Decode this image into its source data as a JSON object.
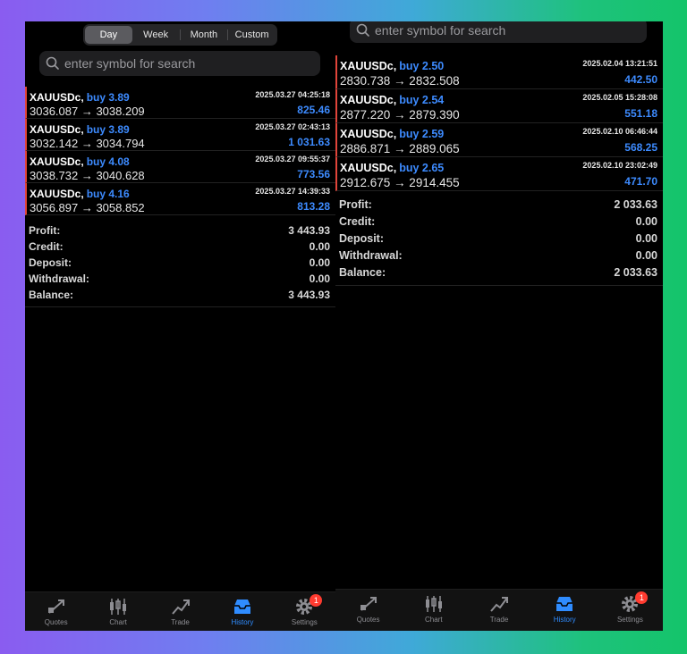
{
  "left": {
    "period_tabs": [
      "Day",
      "Week",
      "Month",
      "Custom"
    ],
    "active_period": "Day",
    "search": {
      "placeholder": "enter symbol for search"
    },
    "deals": [
      {
        "symbol": "XAUUSDc,",
        "side": "buy 3.89",
        "time": "2025.03.27 04:25:18",
        "prices": "3036.087 → 3038.209",
        "profit": "825.46"
      },
      {
        "symbol": "XAUUSDc,",
        "side": "buy 3.89",
        "time": "2025.03.27 02:43:13",
        "prices": "3032.142 → 3034.794",
        "profit": "1 031.63"
      },
      {
        "symbol": "XAUUSDc,",
        "side": "buy 4.08",
        "time": "2025.03.27 09:55:37",
        "prices": "3038.732 → 3040.628",
        "profit": "773.56"
      },
      {
        "symbol": "XAUUSDc,",
        "side": "buy 4.16",
        "time": "2025.03.27 14:39:33",
        "prices": "3056.897 → 3058.852",
        "profit": "813.28"
      }
    ],
    "summary": [
      {
        "label": "Profit:",
        "value": "3 443.93"
      },
      {
        "label": "Credit:",
        "value": "0.00"
      },
      {
        "label": "Deposit:",
        "value": "0.00"
      },
      {
        "label": "Withdrawal:",
        "value": "0.00"
      },
      {
        "label": "Balance:",
        "value": "3 443.93"
      }
    ],
    "tabs": [
      {
        "label": "Quotes",
        "icon": "quotes-icon"
      },
      {
        "label": "Chart",
        "icon": "chart-icon"
      },
      {
        "label": "Trade",
        "icon": "trade-icon"
      },
      {
        "label": "History",
        "icon": "history-icon"
      },
      {
        "label": "Settings",
        "icon": "settings-icon",
        "badge": "1"
      }
    ],
    "active_tab": "History"
  },
  "right": {
    "search": {
      "placeholder": "enter symbol for search"
    },
    "deals": [
      {
        "symbol": "XAUUSDc,",
        "side": "buy 2.50",
        "time": "2025.02.04 13:21:51",
        "prices": "2830.738 → 2832.508",
        "profit": "442.50"
      },
      {
        "symbol": "XAUUSDc,",
        "side": "buy 2.54",
        "time": "2025.02.05 15:28:08",
        "prices": "2877.220 → 2879.390",
        "profit": "551.18"
      },
      {
        "symbol": "XAUUSDc,",
        "side": "buy 2.59",
        "time": "2025.02.10 06:46:44",
        "prices": "2886.871 → 2889.065",
        "profit": "568.25"
      },
      {
        "symbol": "XAUUSDc,",
        "side": "buy 2.65",
        "time": "2025.02.10 23:02:49",
        "prices": "2912.675 → 2914.455",
        "profit": "471.70"
      }
    ],
    "summary": [
      {
        "label": "Profit:",
        "value": "2 033.63"
      },
      {
        "label": "Credit:",
        "value": "0.00"
      },
      {
        "label": "Deposit:",
        "value": "0.00"
      },
      {
        "label": "Withdrawal:",
        "value": "0.00"
      },
      {
        "label": "Balance:",
        "value": "2 033.63"
      }
    ],
    "tabs": [
      {
        "label": "Quotes",
        "icon": "quotes-icon"
      },
      {
        "label": "Chart",
        "icon": "chart-icon"
      },
      {
        "label": "Trade",
        "icon": "trade-icon"
      },
      {
        "label": "History",
        "icon": "history-icon"
      },
      {
        "label": "Settings",
        "icon": "settings-icon",
        "badge": "1"
      }
    ],
    "active_tab": "History"
  },
  "colors": {
    "accent": "#2f8cff",
    "buy": "#3d8bff",
    "deal_marker": "#e0453a",
    "badge": "#ff3b30"
  }
}
